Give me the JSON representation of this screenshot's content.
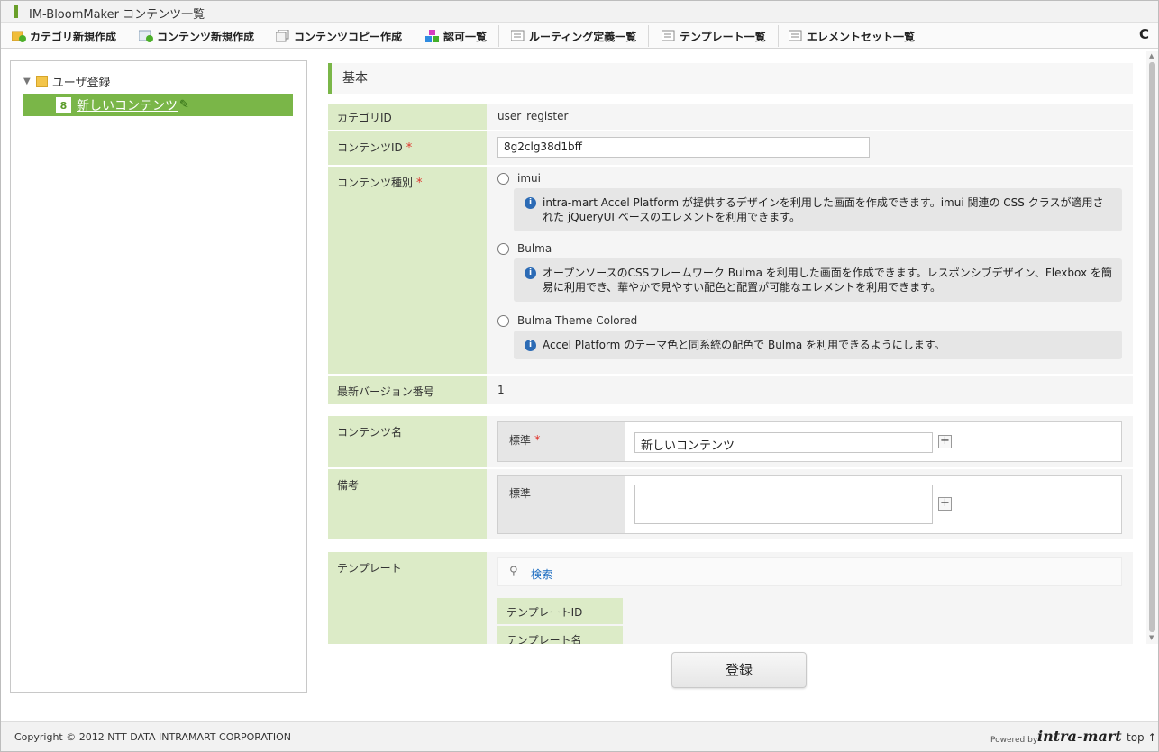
{
  "window": {
    "title": "IM-BloomMaker コンテンツ一覧"
  },
  "toolbar": {
    "items": [
      {
        "label": "カテゴリ新規作成",
        "icon": "folder-add-icon"
      },
      {
        "label": "コンテンツ新規作成",
        "icon": "document-add-icon"
      },
      {
        "label": "コンテンツコピー作成",
        "icon": "copy-icon"
      },
      {
        "label": "認可一覧",
        "icon": "blocks-icon"
      },
      {
        "label": "ルーティング定義一覧",
        "icon": "list-icon"
      },
      {
        "label": "テンプレート一覧",
        "icon": "list-icon"
      },
      {
        "label": "エレメントセット一覧",
        "icon": "list-icon"
      }
    ],
    "refresh_icon": "C"
  },
  "tree": {
    "root_label": "ユーザ登録",
    "selected": {
      "badge": "8",
      "label": "新しいコンテンツ"
    }
  },
  "form": {
    "section_title": "基本",
    "category_id": {
      "label": "カテゴリID",
      "value": "user_register"
    },
    "content_id": {
      "label": "コンテンツID",
      "required": "*",
      "value": "8g2clg38d1bff"
    },
    "content_type": {
      "label": "コンテンツ種別",
      "required": "*",
      "options": [
        {
          "label": "imui",
          "info": "intra-mart Accel Platform が提供するデザインを利用した画面を作成できます。imui 関連の CSS クラスが適用された jQueryUI ベースのエレメントを利用できます。"
        },
        {
          "label": "Bulma",
          "info": "オープンソースのCSSフレームワーク Bulma を利用した画面を作成できます。レスポンシブデザイン、Flexbox を簡易に利用でき、華やかで見やすい配色と配置が可能なエレメントを利用できます。"
        },
        {
          "label": "Bulma Theme Colored",
          "info": "Accel Platform のテーマ色と同系統の配色で Bulma を利用できるようにします。"
        }
      ]
    },
    "latest_version": {
      "label": "最新バージョン番号",
      "value": "1"
    },
    "content_name": {
      "label": "コンテンツ名",
      "sub_label": "標準",
      "required": "*",
      "value": "新しいコンテンツ"
    },
    "remarks": {
      "label": "備考",
      "sub_label": "標準",
      "value": ""
    },
    "template": {
      "label": "テンプレート",
      "search_label": "検索",
      "id_label": "テンプレートID",
      "name_label": "テンプレート名"
    },
    "submit_label": "登録"
  },
  "footer": {
    "copyright": "Copyright © 2012 NTT DATA INTRAMART CORPORATION",
    "powered_by": "Powered by",
    "brand": "intra-mart",
    "top_link": "top ↑"
  }
}
